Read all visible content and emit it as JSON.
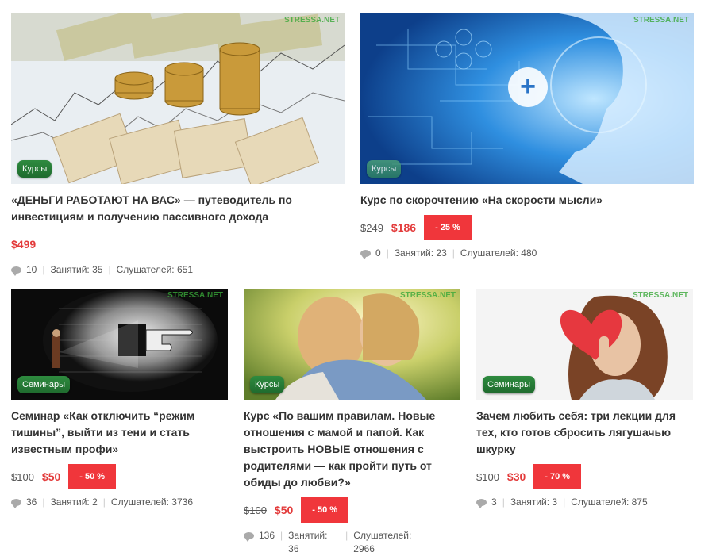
{
  "watermark": "STRESSA.NET",
  "cards": [
    {
      "badge": "Курсы",
      "title": "«ДЕНЬГИ РАБОТАЮТ НА ВАС» — путеводитель по инвестициям и получению пассивного дохода",
      "new_price": "$499",
      "comments": "10",
      "lessons": "Занятий: 35",
      "listeners": "Слушателей: 651"
    },
    {
      "badge": "Курсы",
      "title": "Курс по скорочтению «На скорости мысли»",
      "old_price": "$249",
      "new_price": "$186",
      "discount": "- 25 %",
      "comments": "0",
      "lessons": "Занятий: 23",
      "listeners": "Слушателей: 480"
    },
    {
      "badge": "Семинары",
      "title": "Семинар «Как отключить “режим тишины”, выйти из тени и стать известным профи»",
      "old_price": "$100",
      "new_price": "$50",
      "discount": "- 50 %",
      "comments": "36",
      "lessons": "Занятий: 2",
      "listeners": "Слушателей: 3736"
    },
    {
      "badge": "Курсы",
      "title": "Курс «По вашим правилам. Новые отношения с мамой и папой. Как выстроить НОВЫЕ отношения с родителями — как пройти путь от обиды до любви?»",
      "old_price": "$100",
      "new_price": "$50",
      "discount": "- 50 %",
      "comments": "136",
      "lessons": "Занятий: 36",
      "listeners": "Слушателей: 2966"
    },
    {
      "badge": "Семинары",
      "title": "Зачем любить себя: три лекции для тех, кто готов сбросить лягушачью шкурку",
      "old_price": "$100",
      "new_price": "$30",
      "discount": "- 70 %",
      "comments": "3",
      "lessons": "Занятий: 3",
      "listeners": "Слушателей: 875"
    }
  ],
  "colors": {
    "badge_green": "#1f6b2e",
    "price_red": "#e33b3b",
    "discount_red": "#f0363b"
  }
}
